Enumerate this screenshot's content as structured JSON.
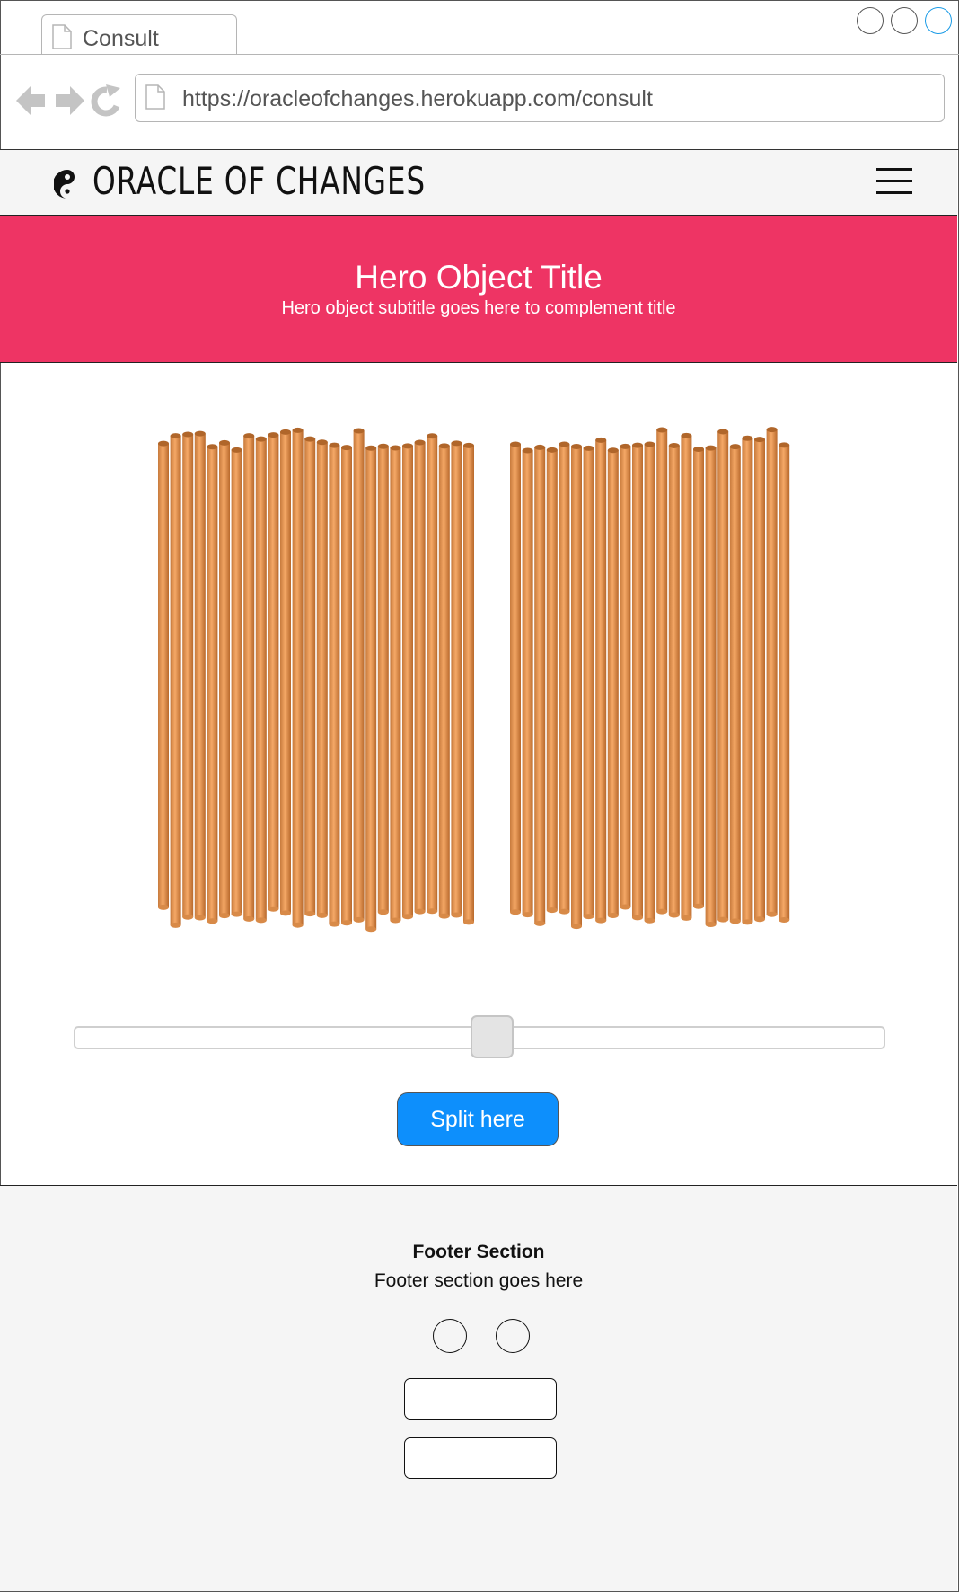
{
  "browser": {
    "tab_title": "Consult",
    "url": "https://oracleofchanges.herokuapp.com/consult"
  },
  "header": {
    "brand": "ORACLE OF CHANGES",
    "logo_icon": "yin-yang-icon",
    "menu_icon": "hamburger-menu-icon"
  },
  "hero": {
    "title": "Hero Object Title",
    "subtitle": "Hero object subtitle goes here to complement title",
    "background": "#ee3464"
  },
  "sticks": {
    "left_pile_count": 26,
    "right_pile_count": 23,
    "color": "#f0a060"
  },
  "split_slider": {
    "value_fraction": 0.52
  },
  "actions": {
    "split_label": "Split here",
    "accent": "#0d8ffc"
  },
  "footer": {
    "title": "Footer Section",
    "text": "Footer section goes here"
  }
}
